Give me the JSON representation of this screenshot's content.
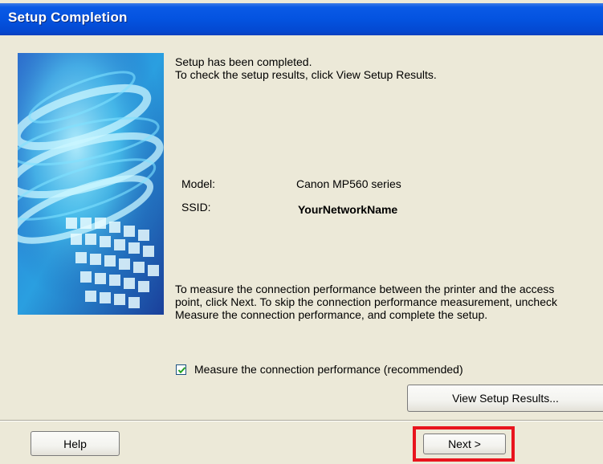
{
  "window": {
    "title": "Setup Completion"
  },
  "intro": {
    "line1": "Setup has been completed.",
    "line2": "To check the setup results, click View Setup Results."
  },
  "details": {
    "model_label": "Model:",
    "model_value": "Canon MP560 series",
    "ssid_label": "SSID:",
    "ssid_value": "YourNetworkName"
  },
  "performance_text": {
    "line1": "To measure the connection performance between the printer and the access",
    "line2": "point, click Next. To skip the connection performance measurement, uncheck",
    "line3": "Measure the connection performance, and complete the setup."
  },
  "checkbox": {
    "label": "Measure the connection performance (recommended)",
    "checked": true
  },
  "buttons": {
    "view_results": "View Setup Results...",
    "help": "Help",
    "next": "Next >"
  },
  "colors": {
    "titlebar": "#0453e0",
    "dialog_bg": "#ece9d8",
    "highlight": "#e8141d"
  }
}
